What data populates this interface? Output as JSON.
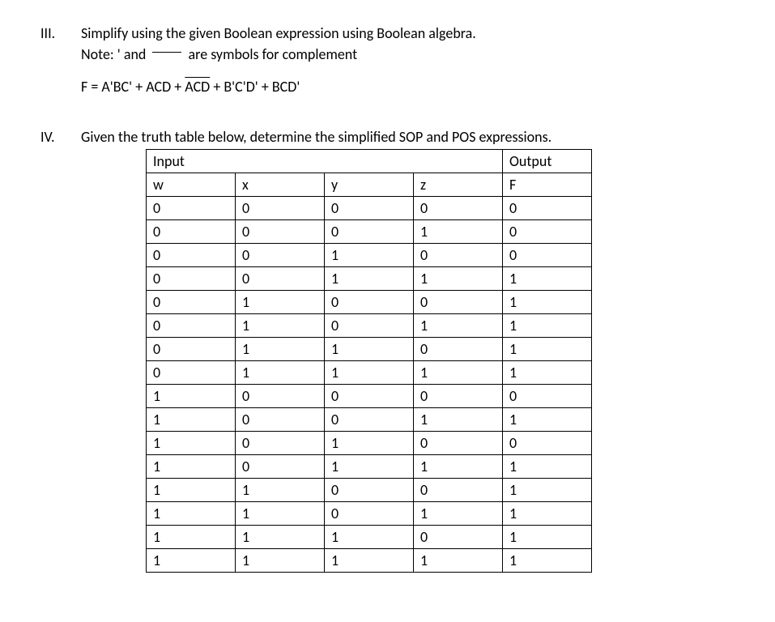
{
  "sections": {
    "iii": {
      "num": "III.",
      "line1a": "Simplify using the given Boolean expression using Boolean algebra.",
      "line2a": "Note: ' and",
      "line2b": "are symbols for complement",
      "eq_pre": "F = A'BC' + ACD + ",
      "eq_over": "ACD",
      "eq_post": " + B'C'D' + BCD'"
    },
    "iv": {
      "num": "IV.",
      "line1": "Given the truth table below, determine the simplified SOP and POS expressions."
    }
  },
  "table": {
    "header_input": "Input",
    "header_output": "Output",
    "cols": {
      "w": "w",
      "x": "x",
      "y": "y",
      "z": "z",
      "f": "F"
    },
    "rows": [
      {
        "w": "0",
        "x": "0",
        "y": "0",
        "z": "0",
        "f": "0"
      },
      {
        "w": "0",
        "x": "0",
        "y": "0",
        "z": "1",
        "f": "0"
      },
      {
        "w": "0",
        "x": "0",
        "y": "1",
        "z": "0",
        "f": "0"
      },
      {
        "w": "0",
        "x": "0",
        "y": "1",
        "z": "1",
        "f": "1"
      },
      {
        "w": "0",
        "x": "1",
        "y": "0",
        "z": "0",
        "f": "1"
      },
      {
        "w": "0",
        "x": "1",
        "y": "0",
        "z": "1",
        "f": "1"
      },
      {
        "w": "0",
        "x": "1",
        "y": "1",
        "z": "0",
        "f": "1"
      },
      {
        "w": "0",
        "x": "1",
        "y": "1",
        "z": "1",
        "f": "1"
      },
      {
        "w": "1",
        "x": "0",
        "y": "0",
        "z": "0",
        "f": "0"
      },
      {
        "w": "1",
        "x": "0",
        "y": "0",
        "z": "1",
        "f": "1"
      },
      {
        "w": "1",
        "x": "0",
        "y": "1",
        "z": "0",
        "f": "0"
      },
      {
        "w": "1",
        "x": "0",
        "y": "1",
        "z": "1",
        "f": "1"
      },
      {
        "w": "1",
        "x": "1",
        "y": "0",
        "z": "0",
        "f": "1"
      },
      {
        "w": "1",
        "x": "1",
        "y": "0",
        "z": "1",
        "f": "1"
      },
      {
        "w": "1",
        "x": "1",
        "y": "1",
        "z": "0",
        "f": "1"
      },
      {
        "w": "1",
        "x": "1",
        "y": "1",
        "z": "1",
        "f": "1"
      }
    ]
  }
}
